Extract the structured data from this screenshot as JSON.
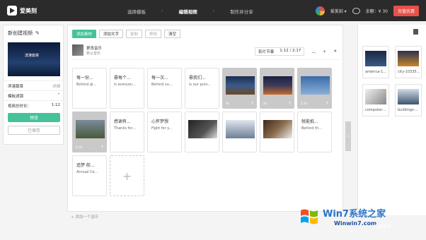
{
  "app": {
    "name": "爱美刻"
  },
  "steps": [
    {
      "label": "选择模板"
    },
    {
      "label": "编辑视频"
    },
    {
      "label": "制作并分享"
    }
  ],
  "user": {
    "name": "爱美刻 ▾",
    "balance": "余额：¥ 30",
    "vip_button": "充值优惠"
  },
  "left": {
    "project_title": "新创建视频",
    "preview_text": "滨港篇章",
    "rows": [
      {
        "left": "滨港篇章",
        "right": "详细"
      },
      {
        "left": "模板滤镜",
        "right": ""
      },
      {
        "left": "视频总时长：",
        "right": "1:12"
      }
    ],
    "preview_button": "预览",
    "saved_button": "已保存"
  },
  "toolbar": {
    "add_media": "添加素材",
    "add_text": "添加文字",
    "copy": "复制",
    "remove": "移除",
    "clear": "清空"
  },
  "music": {
    "name": "更改音乐",
    "sub": "默认音乐",
    "rhythm": "影片节奏",
    "time": "1:12 / 2:17"
  },
  "cards": [
    {
      "kind": "text",
      "title": "每一份...",
      "sub": "Behind gl..."
    },
    {
      "kind": "text",
      "title": "悬每个...",
      "sub": "is everyon..."
    },
    {
      "kind": "text",
      "title": "每一次...",
      "sub": "Behind su..."
    },
    {
      "kind": "text",
      "title": "悬我们...",
      "sub": "is our purs..."
    },
    {
      "kind": "image",
      "dur": "4s",
      "photo": "night-road"
    },
    {
      "kind": "image",
      "dur": "4s",
      "photo": "city-night"
    },
    {
      "kind": "image",
      "dur": "2.4s",
      "photo": "blue-grad"
    },
    {
      "kind": "image",
      "dur": "2.4s",
      "photo": "tower-dusk"
    },
    {
      "kind": "text",
      "title": "感谢有...",
      "sub": "Thanks for..."
    },
    {
      "kind": "text",
      "title": "心怀梦想",
      "sub": "Fight for y..."
    },
    {
      "kind": "image-plain",
      "photo": "handshake"
    },
    {
      "kind": "image-plain",
      "photo": "buildings"
    },
    {
      "kind": "image-plain",
      "photo": "laptop"
    },
    {
      "kind": "text",
      "title": "就能抵...",
      "sub": "Behind th..."
    },
    {
      "kind": "text",
      "title": "追梦·前...",
      "sub": "Annual Ce..."
    }
  ],
  "bottom_music": "+ 添加一个音乐",
  "assets": [
    {
      "name": "america-1...",
      "photo": "america"
    },
    {
      "name": "city-10335...",
      "photo": "city"
    },
    {
      "name": "computer-...",
      "photo": "computer"
    },
    {
      "name": "buildings-...",
      "photo": "buildings2"
    }
  ],
  "watermark": {
    "title": "Win7系统之家",
    "url": "Winwin7.com",
    "consult": "欢迎咨询"
  },
  "colors": {
    "accent": "#45c29a",
    "topbar": "#2b2b2b",
    "vip": "#e8514a"
  }
}
